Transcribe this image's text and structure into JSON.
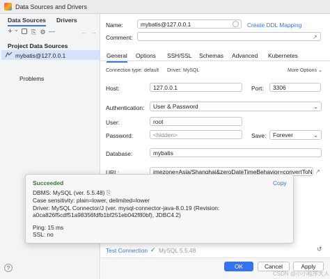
{
  "window": {
    "title": "Data Sources and Drivers"
  },
  "left": {
    "tabs": [
      "Data Sources",
      "Drivers"
    ],
    "section_title": "Project Data Sources",
    "datasource_label": "mybatis@127.0.0.1",
    "problems_label": "Problems",
    "toolbar": {
      "add": "+",
      "dropdown": "⌄",
      "copy": "⎘",
      "settings": "⚙",
      "remove": "—",
      "back": "←",
      "forward": "→"
    },
    "help": "?"
  },
  "form": {
    "name_label": "Name:",
    "name_value": "mybatis@127.0.0.1",
    "create_ddl": "Create DDL Mapping",
    "comment_label": "Comment:",
    "tabs": [
      "General",
      "Options",
      "SSH/SSL",
      "Schemas",
      "Advanced",
      "Kubernetes"
    ],
    "conn_type_label": "Connection type:",
    "conn_type_value": "default",
    "driver_label": "Driver:",
    "driver_value": "MySQL",
    "more_options": "More Options",
    "host_label": "Host:",
    "host_value": "127.0.0.1",
    "port_label": "Port:",
    "port_value": "3306",
    "auth_label": "Authentication:",
    "auth_value": "User & Password",
    "user_label": "User:",
    "user_value": "root",
    "password_label": "Password:",
    "password_placeholder": "<hidden>",
    "save_label": "Save:",
    "save_value": "Forever",
    "database_label": "Database:",
    "database_value": "mybatis",
    "url_label": "URL:",
    "url_value": "imezone=Asia/Shanghai&zeroDateTimeBehavior=convertToNull"
  },
  "popup": {
    "title": "Succeeded",
    "copy": "Copy",
    "lines": [
      "DBMS: MySQL (ver. 5.5.48)",
      "Case sensitivity: plain=lower, delimited=lower",
      "Driver: MySQL Connector/J (ver. mysql-connector-java-8.0.19 (Revision:",
      "a0ca826f5cdf51a98356fdfb1bf251eb042f80bf), JDBC4.2)",
      "Ping: 15 ms",
      "SSL: no"
    ]
  },
  "footer": {
    "test_connection": "Test Connection",
    "check": "✓",
    "test_result": "MySQL 5.5.48",
    "ok": "OK",
    "cancel": "Cancel",
    "apply": "Apply"
  },
  "watermark": "CSDN @小小程序大人物",
  "colors": {
    "accent": "#3574f0",
    "success": "#2e7d32",
    "selection": "#d4e2fb"
  }
}
